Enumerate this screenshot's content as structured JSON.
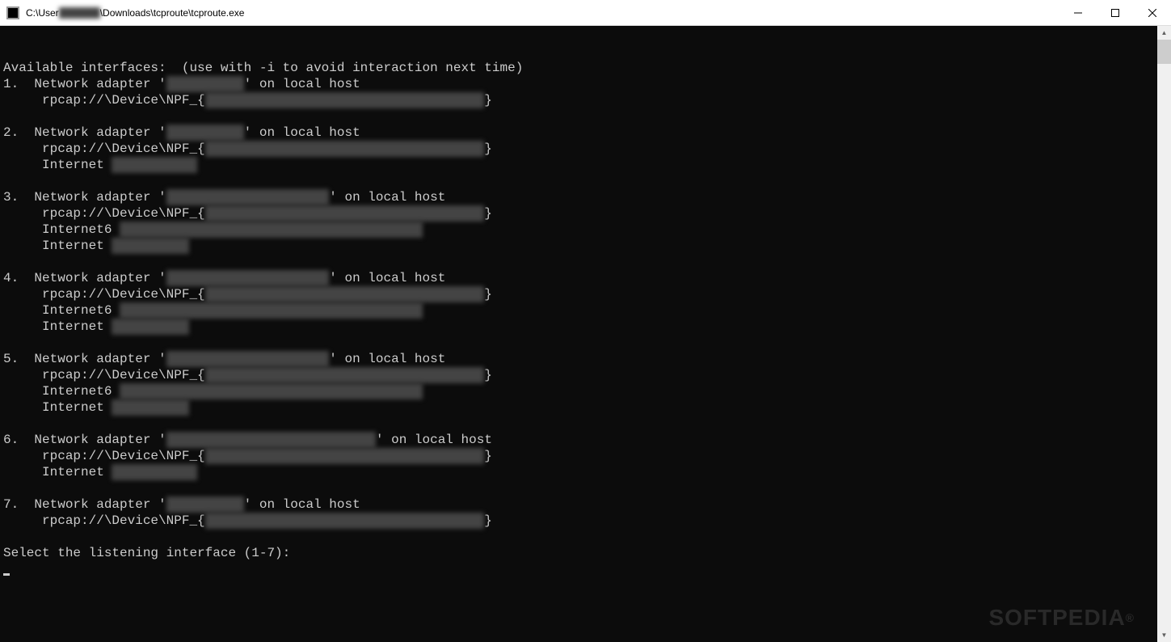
{
  "window": {
    "title": "C:\\User██████\\Downloads\\tcproute\\tcproute.exe"
  },
  "title_parts": {
    "p1": "C:\\User",
    "red1": "██████",
    "p2": "\\Downloads\\tcproute\\tcproute.exe"
  },
  "console": {
    "header": "Available interfaces:  (use with -i to avoid interaction next time)",
    "prompt": "Select the listening interface (1-7):",
    "interfaces": [
      {
        "num": "1.  ",
        "prefix": "Network adapter '",
        "name_redacted": "██████████",
        "after_name": "' on local host",
        "rpcap_prefix": "     rpcap://\\Device\\NPF_{",
        "rpcap_redacted": "████████-████-████-████-████████████",
        "rpcap_suffix": "}",
        "extras": []
      },
      {
        "num": "2.  ",
        "prefix": "Network adapter '",
        "name_redacted": "██████████",
        "after_name": "' on local host",
        "rpcap_prefix": "     rpcap://\\Device\\NPF_{",
        "rpcap_redacted": "████████-████-████-████-████████████",
        "rpcap_suffix": "}",
        "extras": [
          {
            "label": "     Internet ",
            "redacted": "███.██.█.██"
          }
        ]
      },
      {
        "num": "3.  ",
        "prefix": "Network adapter '",
        "name_redacted": "█████████ ███████████",
        "after_name": "' on local host",
        "rpcap_prefix": "     rpcap://\\Device\\NPF_{",
        "rpcap_redacted": "████████-████-████-████-████████████",
        "rpcap_suffix": "}",
        "extras": [
          {
            "label": "     Internet6 ",
            "redacted": "████:████:████:████:████:████:████:████"
          },
          {
            "label": "     Internet ",
            "redacted": "██.██.██.█"
          }
        ]
      },
      {
        "num": "4.  ",
        "prefix": "Network adapter '",
        "name_redacted": "█████████ ███████████",
        "after_name": "' on local host",
        "rpcap_prefix": "     rpcap://\\Device\\NPF_{",
        "rpcap_redacted": "████████-████-████-████-████████████",
        "rpcap_suffix": "}",
        "extras": [
          {
            "label": "     Internet6 ",
            "redacted": "████:████:████:████:████:████:████:████"
          },
          {
            "label": "     Internet ",
            "redacted": "██.██.██.█"
          }
        ]
      },
      {
        "num": "5.  ",
        "prefix": "Network adapter '",
        "name_redacted": "█████████ ███████████",
        "after_name": "' on local host",
        "rpcap_prefix": "     rpcap://\\Device\\NPF_{",
        "rpcap_redacted": "████████-████-████-████-████████████",
        "rpcap_suffix": "}",
        "extras": [
          {
            "label": "     Internet6 ",
            "redacted": "████:████:████:████:████:████:████:████"
          },
          {
            "label": "     Internet ",
            "redacted": "██.██.██.█"
          }
        ]
      },
      {
        "num": "6.  ",
        "prefix": "Network adapter '",
        "name_redacted": "██████ ██ ██ █████ ████████",
        "after_name": "' on local host",
        "rpcap_prefix": "     rpcap://\\Device\\NPF_{",
        "rpcap_redacted": "████████-████-████-████-████████████",
        "rpcap_suffix": "}",
        "extras": [
          {
            "label": "     Internet ",
            "redacted": "███.██.█.██"
          }
        ]
      },
      {
        "num": "7.  ",
        "prefix": "Network adapter '",
        "name_redacted": "██████████",
        "after_name": "' on local host",
        "rpcap_prefix": "     rpcap://\\Device\\NPF_{",
        "rpcap_redacted": "████████-████-████-████-████████████",
        "rpcap_suffix": "}",
        "extras": []
      }
    ]
  },
  "watermark": "SOFTPEDIA"
}
